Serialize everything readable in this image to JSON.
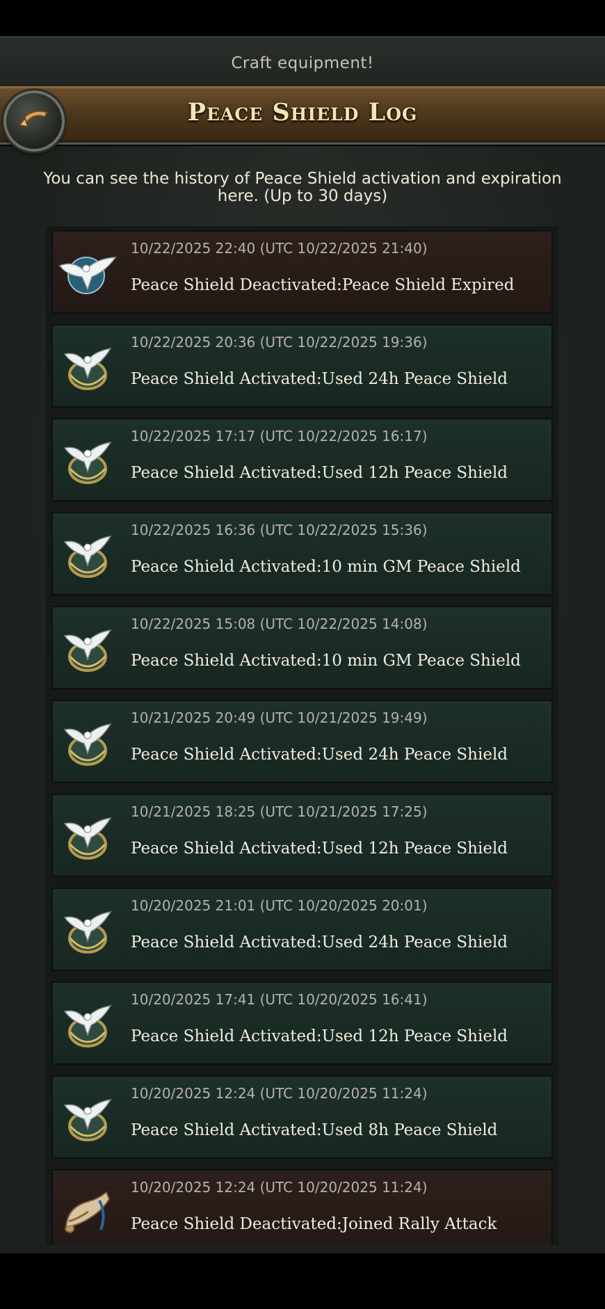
{
  "banner": {
    "text": "Craft equipment!"
  },
  "header": {
    "title": "Peace Shield Log",
    "back_icon": "back-arrow-icon"
  },
  "description": "You can see the history of Peace Shield activation and expiration here. (Up to 30 days)",
  "entries": [
    {
      "time": "10/22/2025 22:40 (UTC 10/22/2025 21:40)",
      "message": "Peace Shield Deactivated:Peace Shield Expired",
      "type": "deactivated",
      "icon": "dove-globe-icon"
    },
    {
      "time": "10/22/2025 20:36 (UTC 10/22/2025 19:36)",
      "message": "Peace Shield Activated:Used 24h Peace Shield",
      "type": "activated",
      "icon": "dove-shield-icon"
    },
    {
      "time": "10/22/2025 17:17 (UTC 10/22/2025 16:17)",
      "message": "Peace Shield Activated:Used 12h Peace Shield",
      "type": "activated",
      "icon": "dove-shield-icon"
    },
    {
      "time": "10/22/2025 16:36 (UTC 10/22/2025 15:36)",
      "message": "Peace Shield Activated:10 min GM Peace Shield",
      "type": "activated",
      "icon": "dove-shield-icon"
    },
    {
      "time": "10/22/2025 15:08 (UTC 10/22/2025 14:08)",
      "message": "Peace Shield Activated:10 min GM Peace Shield",
      "type": "activated",
      "icon": "dove-shield-icon"
    },
    {
      "time": "10/21/2025 20:49 (UTC 10/21/2025 19:49)",
      "message": "Peace Shield Activated:Used 24h Peace Shield",
      "type": "activated",
      "icon": "dove-shield-icon"
    },
    {
      "time": "10/21/2025 18:25 (UTC 10/21/2025 17:25)",
      "message": "Peace Shield Activated:Used 12h Peace Shield",
      "type": "activated",
      "icon": "dove-shield-icon"
    },
    {
      "time": "10/20/2025 21:01 (UTC 10/20/2025 20:01)",
      "message": "Peace Shield Activated:Used 24h Peace Shield",
      "type": "activated",
      "icon": "dove-shield-icon"
    },
    {
      "time": "10/20/2025 17:41 (UTC 10/20/2025 16:41)",
      "message": "Peace Shield Activated:Used 12h Peace Shield",
      "type": "activated",
      "icon": "dove-shield-icon"
    },
    {
      "time": "10/20/2025 12:24 (UTC 10/20/2025 11:24)",
      "message": "Peace Shield Activated:Used 8h Peace Shield",
      "type": "activated",
      "icon": "dove-shield-icon"
    },
    {
      "time": "10/20/2025 12:24 (UTC 10/20/2025 11:24)",
      "message": "Peace Shield Deactivated:Joined Rally Attack",
      "type": "deactivated",
      "icon": "war-horn-icon"
    }
  ],
  "colors": {
    "activated_bg": "#1e302b",
    "deactivated_bg": "#2d201c",
    "title_text": "#f6e3b4"
  }
}
